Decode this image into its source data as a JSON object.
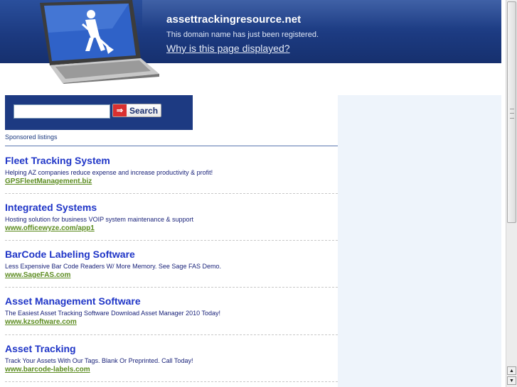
{
  "header": {
    "domain": "assettrackingresource.net",
    "subtitle": "This domain name has just been registered.",
    "why_link": "Why is this page displayed?",
    "laptop_image": "laptop-construction-worker-icon"
  },
  "search": {
    "input_value": "",
    "button_label": "Search",
    "button_icon": "arrow-right-icon"
  },
  "sponsored_label": "Sponsored listings",
  "listings": [
    {
      "title": "Fleet Tracking System",
      "description": "Helping AZ companies reduce expense and increase productivity & profit!",
      "url": "GPSFleetManagement.biz"
    },
    {
      "title": "Integrated Systems",
      "description": "Hosting solution for business VOIP system maintenance & support",
      "url": "www.officewyze.com/app1"
    },
    {
      "title": "BarCode Labeling Software",
      "description": "Less Expensive Bar Code Readers W/ More Memory. See Sage FAS Demo.",
      "url": "www.SageFAS.com"
    },
    {
      "title": "Asset Management Software",
      "description": "The Easiest Asset Tracking Software Download Asset Manager 2010 Today!",
      "url": "www.kzsoftware.com"
    },
    {
      "title": "Asset Tracking",
      "description": "Track Your Assets With Our Tags. Blank Or Preprinted. Call Today!",
      "url": "www.barcode-labels.com"
    }
  ],
  "colors": {
    "header_blue": "#1c3a80",
    "listing_title": "#1f35c7",
    "listing_url": "#5c8c20",
    "right_panel": "#eef4fb"
  }
}
